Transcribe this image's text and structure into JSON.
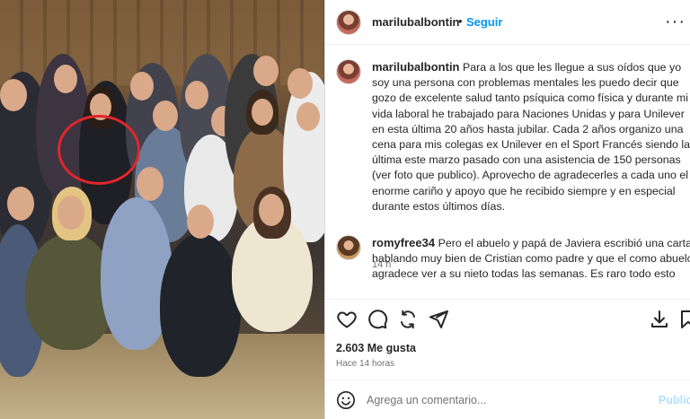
{
  "post": {
    "username": "marilubalbontin",
    "dot": "•",
    "follow_label": "Seguir",
    "more_label": "···"
  },
  "caption": {
    "username": "marilubalbontin",
    "text": "Para a los que les llegue a sus oídos que yo soy una persona con problemas mentales les puedo decir que gozo de excelente salud tanto psíquica como física y durante mi vida laboral he trabajado para Naciones Unidas y para Unilever en esta última 20 años hasta jubilar. Cada 2 años organizo una cena para mis colegas ex Unilever en el Sport Francés siendo la última este marzo pasado con una asistencia de 150 personas (ver foto que publico). Aprovecho de agradecerles a cada uno el enorme cariño y apoyo que he recibido siempre y en especial durante estos últimos días.",
    "time": "14 h"
  },
  "comment": {
    "username": "romyfree34",
    "text": "Pero el abuelo y papá de Javiera escribió una carta hablando muy bien de Cristian como padre y que el como abuelo agradece ver a su nieto todas las semanas. Es raro todo esto"
  },
  "stats": {
    "likes": "2.603 Me gusta",
    "posted": "Hace 14 horas"
  },
  "composer": {
    "placeholder": "Agrega un comentario...",
    "publish_label": "Publicar"
  },
  "icons": {
    "like": "heart-icon",
    "comment": "comment-icon",
    "repost": "repost-icon",
    "share": "send-icon",
    "save": "save-icon",
    "emoji": "emoji-icon"
  },
  "colors": {
    "accent": "#0095f6",
    "publish_disabled": "#b2dffc",
    "highlight_circle": "#e0262b"
  }
}
